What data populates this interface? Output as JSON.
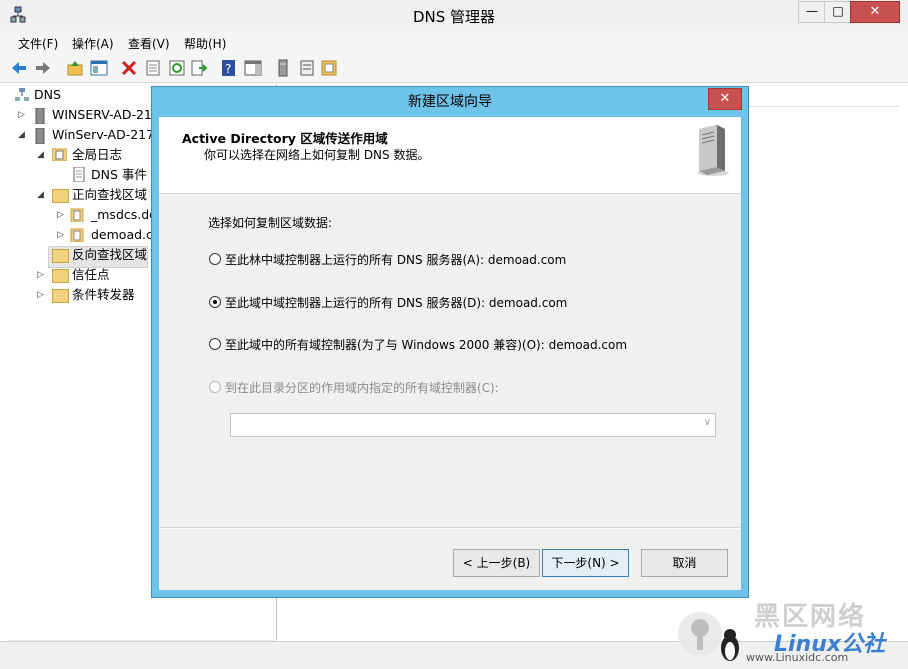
{
  "window": {
    "title": "DNS 管理器",
    "min": "—",
    "max": "□",
    "close": "✕"
  },
  "menu": [
    "文件(F)",
    "操作(A)",
    "查看(V)",
    "帮助(H)"
  ],
  "tree": {
    "root": "DNS",
    "server1": "WINSERV-AD-217",
    "server2": "WinServ-AD-217.",
    "global_logs": "全局日志",
    "dns_events": "DNS 事件",
    "forward_zones": "正向查找区域",
    "msdcs": "_msdcs.de",
    "demoad": "demoad.c",
    "reverse_zones": "反向查找区域",
    "trust_points": "信任点",
    "cond_forwarders": "条件转发器"
  },
  "dialog": {
    "title": "新建区域向导",
    "close": "✕",
    "heading": "Active Directory 区域传送作用域",
    "subheading": "你可以选择在网络上如何复制 DNS 数据。",
    "prompt": "选择如何复制区域数据:",
    "options": [
      {
        "label": "至此林中域控制器上运行的所有 DNS 服务器(A): demoad.com",
        "selected": false,
        "enabled": true
      },
      {
        "label": "至此域中域控制器上运行的所有 DNS 服务器(D): demoad.com",
        "selected": true,
        "enabled": true
      },
      {
        "label": "至此域中的所有域控制器(为了与 Windows 2000 兼容)(O): demoad.com",
        "selected": false,
        "enabled": true
      },
      {
        "label": "到在此目录分区的作用域内指定的所有域控制器(C):",
        "selected": false,
        "enabled": false
      }
    ],
    "combo_value": "",
    "buttons": {
      "back": "< 上一步(B)",
      "next": "下一步(N) >",
      "cancel": "取消"
    }
  },
  "watermark": {
    "line1": "黑区网络",
    "line2": "Linux公社",
    "line3": "www.Linuxidc.com"
  }
}
